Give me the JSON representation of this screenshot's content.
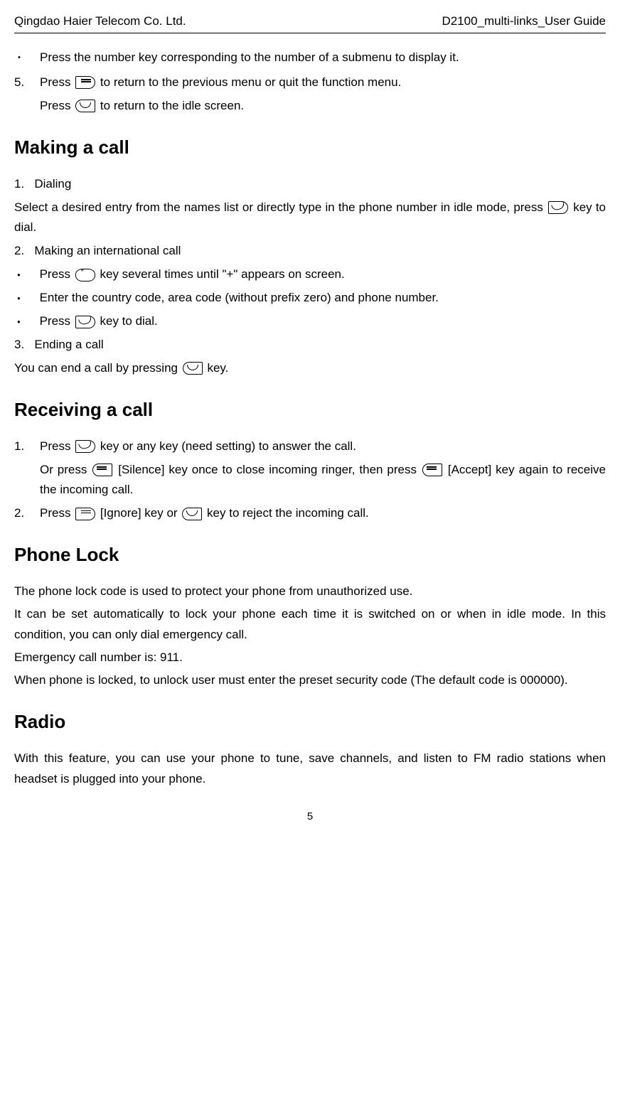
{
  "header": {
    "left": "Qingdao Haier Telecom Co. Ltd.",
    "right": "D2100_multi-links_User Guide"
  },
  "intro": {
    "bullet1": "Press the number key corresponding to the number of a submenu to display it.",
    "step5_a": "Press ",
    "step5_b": " to return to the previous menu or quit the function menu.",
    "step5_sub_a": "Press ",
    "step5_sub_b": " to return to the idle screen."
  },
  "making_call": {
    "title": "Making a call",
    "item1_num": "1.",
    "item1": "Dialing",
    "item1_para_a": "Select a desired entry from the names list or directly type in the phone number in idle mode, press ",
    "item1_para_b": " key to dial.",
    "item2_num": "2.",
    "item2": "Making an international call",
    "b1_a": "Press ",
    "b1_b": " key several times until \"+\" appears on screen.",
    "b2": "Enter the country code, area code (without prefix zero) and phone number.",
    "b3_a": "Press ",
    "b3_b": " key to dial.",
    "item3_num": "3.",
    "item3": "Ending a call",
    "item3_para_a": "You can end a call by pressing ",
    "item3_para_b": " key."
  },
  "receiving_call": {
    "title": "Receiving a call",
    "s1_num": "1.",
    "s1_a": "Press ",
    "s1_b": " key or any key (need setting) to answer the call.",
    "s1_sub_a": "Or press ",
    "s1_sub_b": " [Silence] key once to close incoming ringer, then press ",
    "s1_sub_c": " [Accept] key again to receive the incoming call.",
    "s2_num": "2.",
    "s2_a": "Press ",
    "s2_b": " [Ignore] key or ",
    "s2_c": " key to reject the incoming call."
  },
  "phone_lock": {
    "title": "Phone Lock",
    "p1": "The phone lock code is used to protect your phone from unauthorized use.",
    "p2": "It can be set automatically to lock your phone each time it is switched on or when in idle mode. In this condition, you can only dial emergency call.",
    "p3": "Emergency call number is: 911.",
    "p4": "When phone is locked, to unlock user must enter the preset security code (The default code is 000000)."
  },
  "radio": {
    "title": "Radio",
    "p1": "With this feature, you can use your phone to tune, save channels, and listen to FM radio stations when headset is plugged into your phone."
  },
  "page_number": "5"
}
